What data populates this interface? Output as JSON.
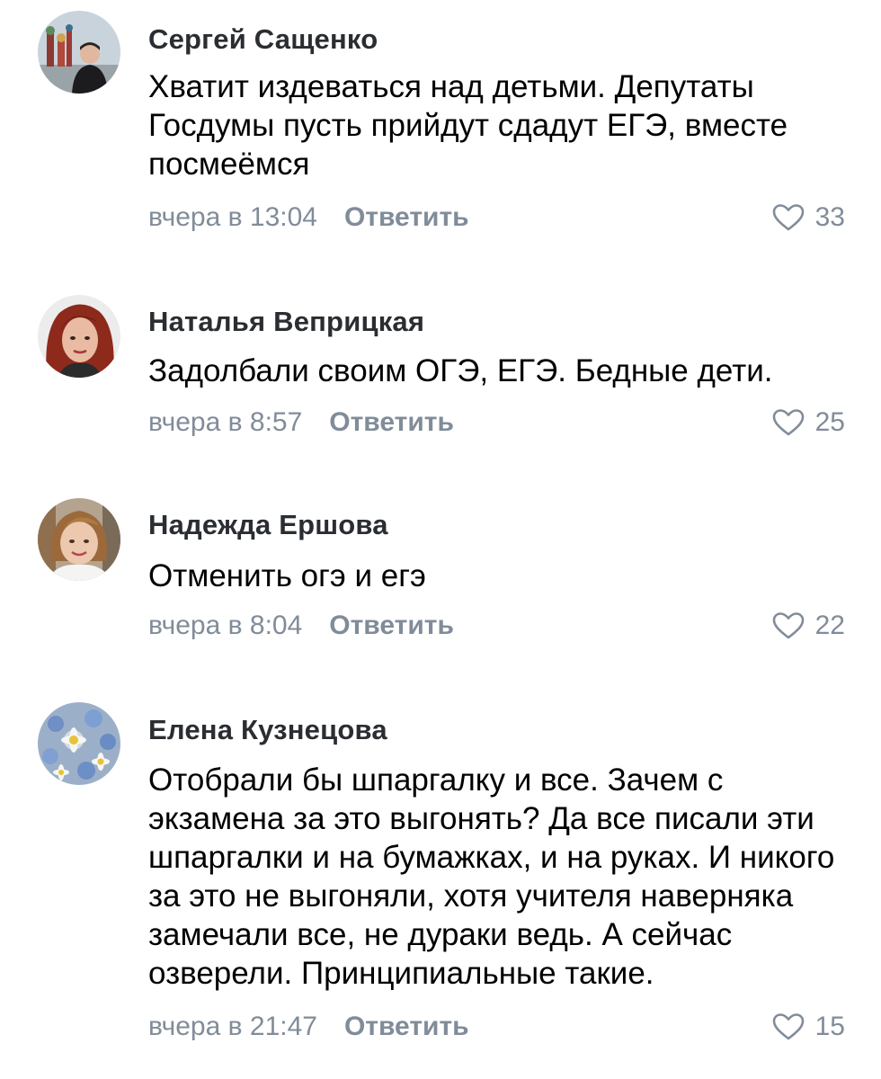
{
  "comments": [
    {
      "author": "Сергей Сащенко",
      "text": "Хватит издеваться над детьми. Депутаты Госдумы пусть прийдут сдадут ЕГЭ, вместе посмеёмся",
      "time": "вчера в 13:04",
      "reply_label": "Ответить",
      "likes": "33",
      "avatar": "avatar-man-kremlin"
    },
    {
      "author": "Наталья Веприцкая",
      "text": "Задолбали своим ОГЭ, ЕГЭ. Бедные дети.",
      "time": "вчера в 8:57",
      "reply_label": "Ответить",
      "likes": "25",
      "avatar": "avatar-red-hair-woman"
    },
    {
      "author": "Надежда Ершова",
      "text": "Отменить огэ и егэ",
      "time": "вчера в 8:04",
      "reply_label": "Ответить",
      "likes": "22",
      "avatar": "avatar-blonde-woman"
    },
    {
      "author": "Елена Кузнецова",
      "text": "Отобрали бы шпаргалку и все. Зачем с экзамена за это выгонять? Да все писали эти шпаргалки и на бумажках, и на руках. И никого за это не выгоняли, хотя учителя наверняка замечали все, не дураки ведь. А сейчас озверели. Принципиальные такие.",
      "time": "вчера в 21:47",
      "reply_label": "Ответить",
      "likes": "15",
      "avatar": "avatar-flowers"
    }
  ],
  "colors": {
    "secondary_text": "#818c99",
    "author_text": "#2a2d31",
    "body_text": "#000000",
    "background": "#ffffff"
  },
  "icons": {
    "like": "heart-outline-icon"
  }
}
